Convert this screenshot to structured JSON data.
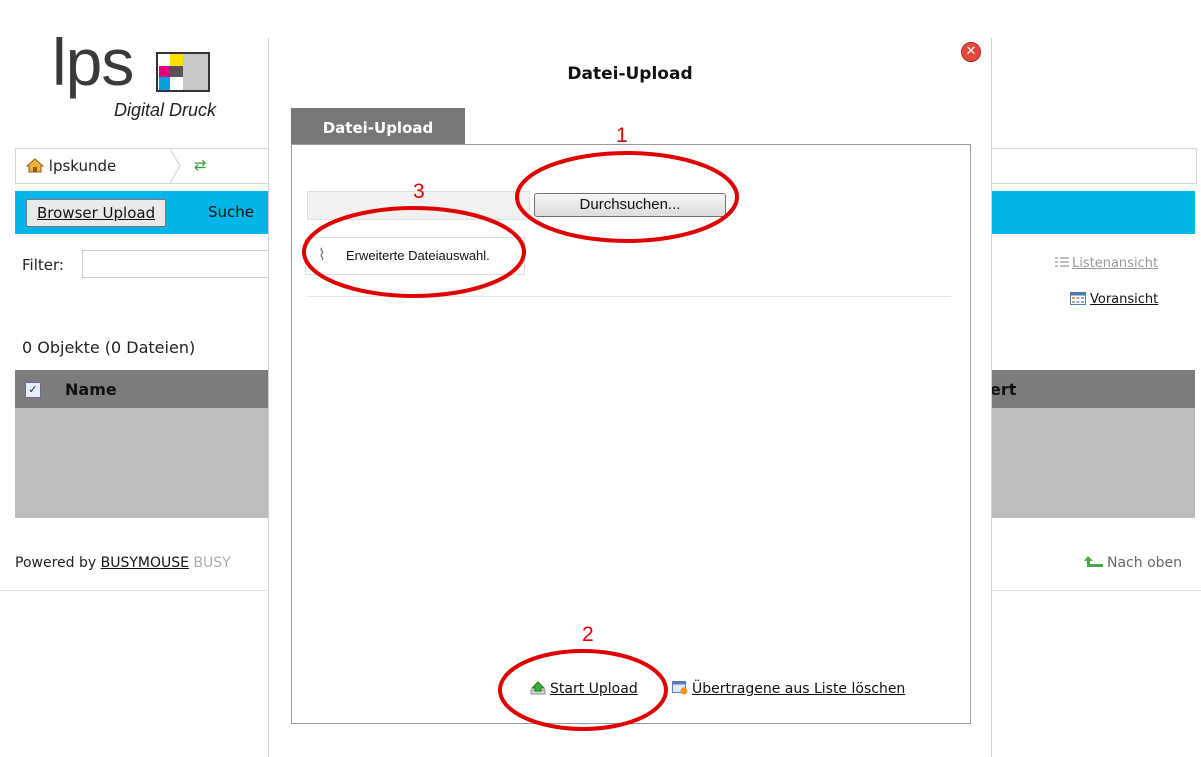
{
  "logo": {
    "brand": "lps",
    "tagline": "Digital Druck"
  },
  "breadcrumb": {
    "home_label": "lpskunde"
  },
  "toolbar": {
    "browser_upload": "Browser Upload",
    "search": "Suche"
  },
  "filter": {
    "label": "Filter:",
    "value": ""
  },
  "view": {
    "list": "Listenansicht",
    "preview": "Voransicht"
  },
  "list": {
    "count": "0 Objekte (0 Dateien)",
    "col_name": "Name",
    "col_right_fragment": "ert"
  },
  "footer": {
    "powered": "Powered by ",
    "brand": "BUSYMOUSE",
    "brand_suffix": " BUSY",
    "to_top": "Nach oben"
  },
  "modal": {
    "title": "Datei-Upload",
    "tab": "Datei-Upload",
    "file_value": "",
    "browse": "Durchsuchen...",
    "extended": "Erweiterte Dateiauswahl.",
    "start_upload": "Start Upload",
    "clear_list": "Übertragene aus Liste löschen"
  },
  "annotations": {
    "one": "1",
    "two": "2",
    "three": "3",
    "color": "#e00000"
  },
  "colors": {
    "accent": "#00b5e8",
    "table_head": "#7c7c7c",
    "table_body": "#bdbdbd"
  }
}
